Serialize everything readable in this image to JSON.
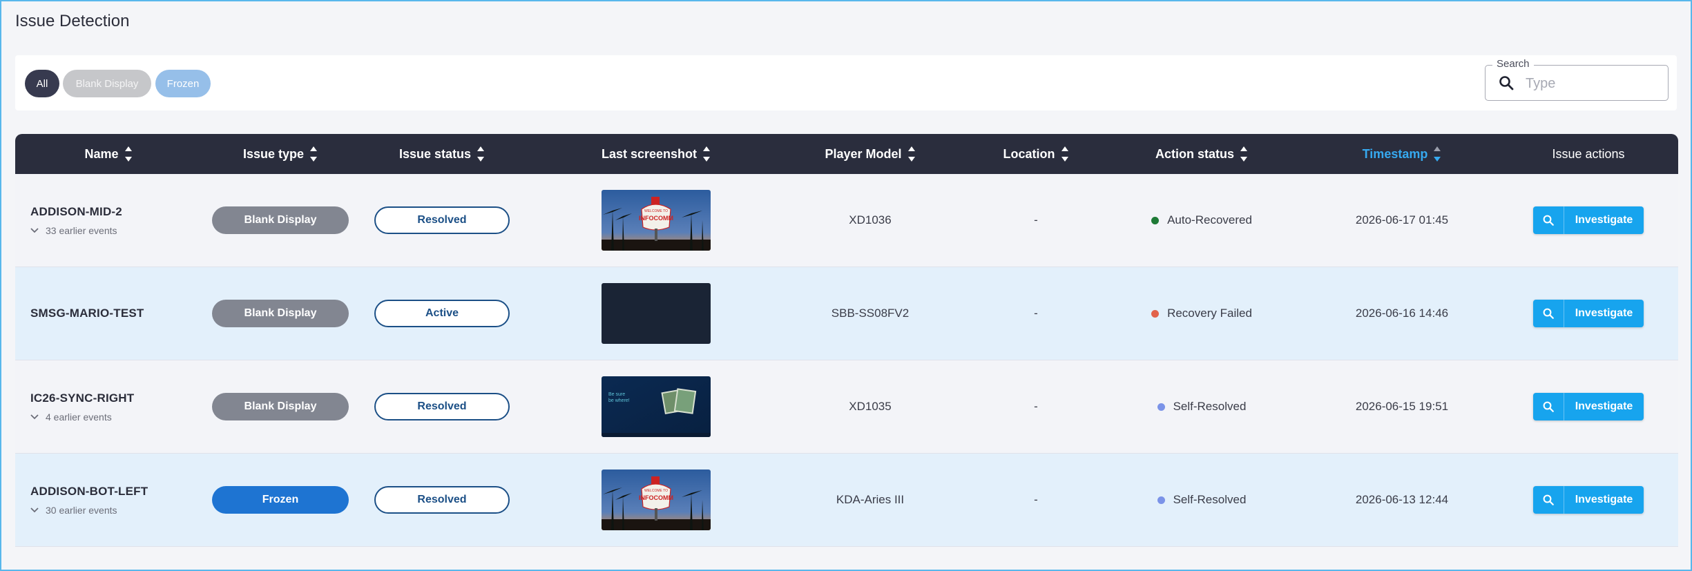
{
  "page": {
    "title": "Issue Detection"
  },
  "filters": {
    "chips": [
      {
        "label": "All",
        "color": "#373a4f"
      },
      {
        "label": "Blank Display",
        "color": "#c6c7ca"
      },
      {
        "label": "Frozen",
        "color": "#96bfe9"
      }
    ]
  },
  "search": {
    "label": "Search",
    "placeholder": "Type",
    "icon": "search-icon"
  },
  "table": {
    "columns": [
      "Name",
      "Issue type",
      "Issue status",
      "Last screenshot",
      "Player Model",
      "Location",
      "Action status",
      "Timestamp",
      "Issue actions"
    ],
    "sorted_column": "Timestamp",
    "action_label": "Investigate",
    "rows": [
      {
        "name": "ADDISON-MID-2",
        "earlier": "33 earlier events",
        "issue_type": "Blank Display",
        "issue_type_color": "#828691",
        "issue_status": "Resolved",
        "screenshot": "las-vegas-sign",
        "player_model": "XD1036",
        "location": "-",
        "action_status": "Auto-Recovered",
        "action_color": "#1e7a36",
        "timestamp": "2026-06-17 01:45"
      },
      {
        "name": "SMSG-MARIO-TEST",
        "earlier": "",
        "issue_type": "Blank Display",
        "issue_type_color": "#828691",
        "issue_status": "Active",
        "screenshot": "blank-dark",
        "player_model": "SBB-SS08FV2",
        "location": "-",
        "action_status": "Recovery Failed",
        "action_color": "#e2624a",
        "timestamp": "2026-06-16 14:46"
      },
      {
        "name": "IC26-SYNC-RIGHT",
        "earlier": "4 earlier events",
        "issue_type": "Blank Display",
        "issue_type_color": "#828691",
        "issue_status": "Resolved",
        "screenshot": "be-sure-slide",
        "player_model": "XD1035",
        "location": "-",
        "action_status": "Self-Resolved",
        "action_color": "#7b93e8",
        "timestamp": "2026-06-15 19:51"
      },
      {
        "name": "ADDISON-BOT-LEFT",
        "earlier": "30 earlier events",
        "issue_type": "Frozen",
        "issue_type_color": "#1e74d2",
        "issue_status": "Resolved",
        "screenshot": "las-vegas-sign",
        "player_model": "KDA-Aries III",
        "location": "-",
        "action_status": "Self-Resolved",
        "action_color": "#7b93e8",
        "timestamp": "2026-06-13 12:44"
      }
    ]
  },
  "thumbs": {
    "las_vegas_sign": {
      "line1": "WELCOME TO",
      "line2": "INFOCOMM"
    },
    "be_sure_slide": {
      "line1": "Be sure",
      "line2": "be where!"
    }
  }
}
